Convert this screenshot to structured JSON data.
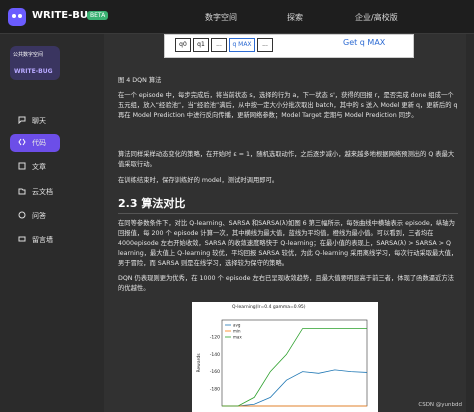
{
  "topbar": {
    "brand": "WRITE-BUG",
    "badge": "BETA",
    "nav": [
      "数字空间",
      "探索",
      "企业/高校版"
    ]
  },
  "sidebar": {
    "card_title": "公共数字空间",
    "card_brand": "WRITE-BUG",
    "items": [
      {
        "label": "聊天",
        "icon": "chat-icon"
      },
      {
        "label": "代码",
        "icon": "code-icon",
        "active": true
      },
      {
        "label": "文章",
        "icon": "article-icon"
      },
      {
        "label": "云文档",
        "icon": "folder-icon"
      },
      {
        "label": "问答",
        "icon": "question-icon"
      },
      {
        "label": "留言墙",
        "icon": "message-icon"
      }
    ]
  },
  "content": {
    "figure_cells": [
      "q0",
      "q1",
      "...",
      "q MAX",
      "..."
    ],
    "figure_label": "Get q MAX",
    "caption": "图 4 DQN 算法",
    "para1": "在一个 episode 中，每步完成后，将当前状态 s，选择的行为 a，下一状态 s'，获得的回报 r，是否完成 done 组成一个五元组，放入“经验池”，当“经验池”满后，从中按一定大小分批次取出 batch，其中的 s 送入 Model 更新 q，更新后的 q 再在 Model Prediction 中进行反向传播，更新网络参数；Model Target 定期与 Model Prediction 同步。",
    "para2": "算法同样采样动态变化的策略，在开始时 ε = 1，随机选取动作，之后逐步减小，越来越多地根据网络预测出的 Q 表最大值采取行动。",
    "para3": "在训练结束时，保存训练好的 model，测试时调用即可。",
    "h2": "2.3 算法对比",
    "para4": "在同等参数条件下，对比 Q-learning、SARSA 和SARSA(λ)如图 6 第三幅所示，每张曲线中横轴表示 episode，纵轴为回报值，每 200 个 episode 计算一次，其中横线为最大值，蓝线为平均值，橙线为最小值。可以看到，三者均在4000episode 左右开始收敛，SARSA 的收敛速度略快于 Q-learning；在最小值的表现上，SARSA(λ) > SARSA > Q learning，最大值上 Q-learning 较优，平均回报 SARSA 较优，为此 Q-learning 采用离线学习，每次行动采取最大值，男于冒险，而 SARSA 则是在线学习，选择较为保守的策略。",
    "para5": "DQN 仍表现则更为优秀，在 1000 个 episode 左右已呈现收敛趋势，且最大值要明显高于前三者，体现了函数逼近方法的优越性。",
    "watermark": "CSDN @yunbdd"
  },
  "chart_data": {
    "type": "line",
    "title": "Q-learning(lr=0.4 gamma=0.95)",
    "xlabel": "",
    "ylabel": "Rewards",
    "ylim": [
      -200,
      -100
    ],
    "yticks": [
      -120,
      -140,
      -160,
      -180
    ],
    "legend": [
      "avg",
      "min",
      "max"
    ],
    "colors": {
      "avg": "#1f77b4",
      "min": "#ff7f0e",
      "max": "#2ca02c"
    },
    "series": [
      {
        "name": "avg",
        "values": [
          -200,
          -200,
          -198,
          -190,
          -170,
          -160,
          -162,
          -158,
          -160,
          -161
        ]
      },
      {
        "name": "min",
        "values": [
          -200,
          -200,
          -200,
          -200,
          -200,
          -200,
          -200,
          -200,
          -200,
          -200
        ]
      },
      {
        "name": "max",
        "values": [
          -200,
          -200,
          -190,
          -160,
          -140,
          -110,
          -110,
          -110,
          -110,
          -110
        ]
      }
    ]
  }
}
